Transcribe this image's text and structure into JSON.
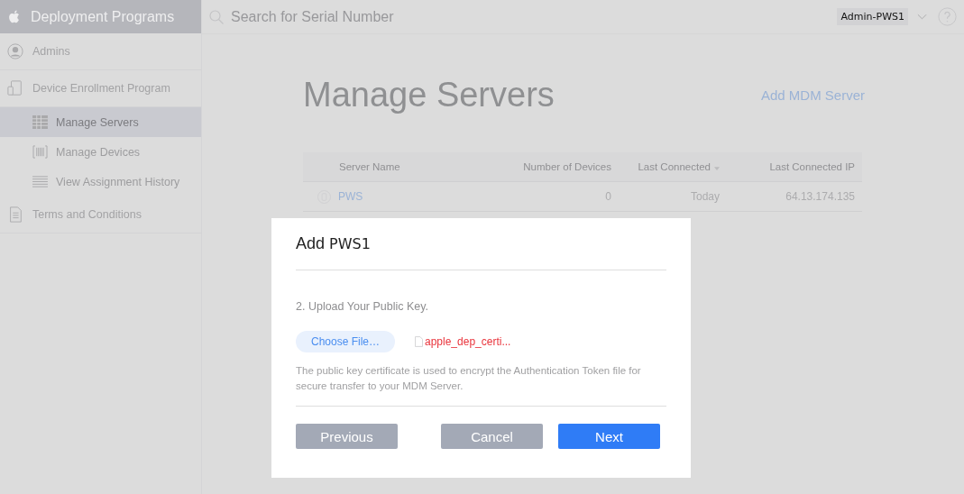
{
  "sidebar": {
    "title": "Deployment Programs",
    "items": [
      {
        "label": "Admins"
      },
      {
        "label": "Device Enrollment Program",
        "children": [
          {
            "label": "Manage Servers",
            "selected": true
          },
          {
            "label": "Manage Devices",
            "selected": false
          },
          {
            "label": "View Assignment History",
            "selected": false
          }
        ]
      },
      {
        "label": "Terms and Conditions"
      }
    ]
  },
  "header": {
    "search": {
      "placeholder": "Search for Serial Number"
    },
    "account": "Admin-PWS1"
  },
  "page": {
    "title": "Manage Servers",
    "action": "Add MDM Server"
  },
  "table": {
    "columns": [
      {
        "label": "Server Name",
        "sorted": false
      },
      {
        "label": "Number of Devices",
        "sorted": false
      },
      {
        "label": "Last Connected",
        "sorted": true
      },
      {
        "label": "Last Connected IP",
        "sorted": false
      }
    ],
    "rows": [
      {
        "cells": [
          "PWS",
          "0",
          "Today",
          "64.13.174.135"
        ]
      }
    ]
  },
  "dialog": {
    "title": "Add",
    "name": "PWS1",
    "step": "2. Upload Your Public Key.",
    "choose": "Choose File…",
    "file": "apple_dep_certi...",
    "note": "The public key certificate is used to encrypt the Authentication Token file for secure transfer to your MDM Server.",
    "buttons": [
      {
        "label": "Previous",
        "kind": "disabled"
      },
      {
        "label": "Cancel",
        "kind": "disabled"
      },
      {
        "label": "Next",
        "kind": "primary"
      }
    ]
  }
}
